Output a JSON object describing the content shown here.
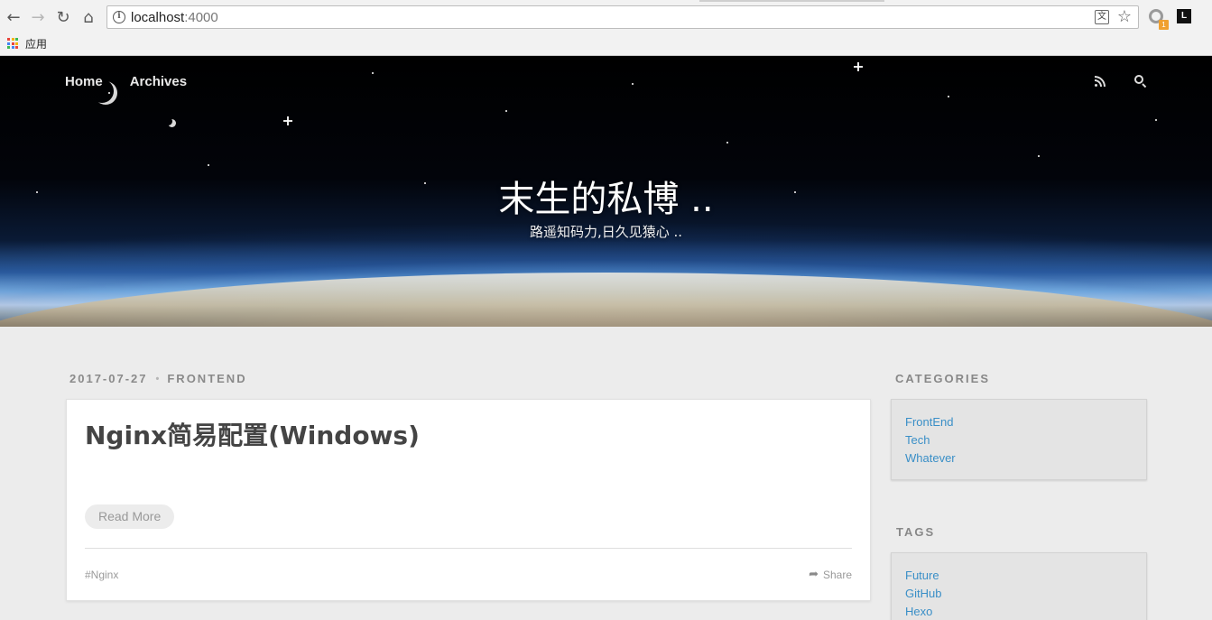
{
  "browser": {
    "url_host": "localhost",
    "url_port": ":4000",
    "bookmarks_label": "应用",
    "translate_icon_label": "文",
    "ext_badge": "1",
    "ext2_label": "L",
    "apps_grid_colors": [
      "#e8453c",
      "#f4b400",
      "#3cba54",
      "#4285f4",
      "#e8453c",
      "#f4b400",
      "#3cba54",
      "#4285f4",
      "#e8453c"
    ]
  },
  "nav": {
    "items": [
      {
        "label": "Home"
      },
      {
        "label": "Archives"
      }
    ],
    "icons": [
      "rss-icon",
      "search-icon"
    ]
  },
  "hero": {
    "title": "末生的私博 ..",
    "subtitle": "路遥知码力,日久见猿心 .."
  },
  "post": {
    "date": "2017-07-27",
    "separator": "•",
    "category": "FrontEnd",
    "title": "Nginx简易配置(Windows)",
    "read_more": "Read More",
    "tag": "#Nginx",
    "share": "Share"
  },
  "sidebar": {
    "categories_heading": "CATEGORIES",
    "categories": [
      "FrontEnd",
      "Tech",
      "Whatever"
    ],
    "tags_heading": "TAGS",
    "tags": [
      "Future",
      "GitHub",
      "Hexo"
    ]
  },
  "colors": {
    "link": "#3a8fc7",
    "page_bg": "#ececec",
    "meta_text": "#8a8a8a"
  }
}
